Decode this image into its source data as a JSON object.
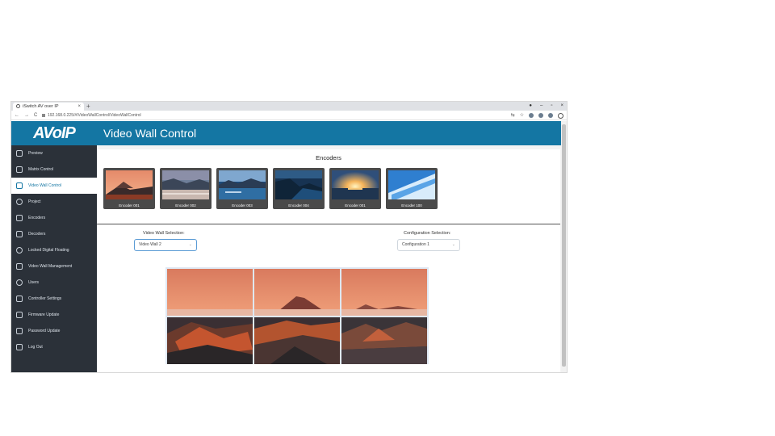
{
  "browser": {
    "tab_title": "iSwitch AV over IP",
    "tab_close": "×",
    "new_tab": "+",
    "url": "192.168.0.225/#/VideoWallControl/VideoWallControl",
    "nav_back": "←",
    "nav_forward": "→",
    "nav_reload": "C",
    "minimize": "–",
    "maximize": "▫",
    "close": "×",
    "menu": "⋮"
  },
  "app": {
    "logo": "AVoIP",
    "page_title": "Video Wall Control"
  },
  "sidebar": {
    "items": [
      {
        "label": "Preview",
        "icon": "preview-icon"
      },
      {
        "label": "Matrix Control",
        "icon": "matrix-icon"
      },
      {
        "label": "Video Wall Control",
        "icon": "video-wall-icon",
        "active": true
      },
      {
        "label": "Project",
        "icon": "project-icon"
      },
      {
        "label": "Encoders",
        "icon": "encoder-icon"
      },
      {
        "label": "Decoders",
        "icon": "decoder-icon"
      },
      {
        "label": "Locked Digital Floating",
        "icon": "gear-icon"
      },
      {
        "label": "Video Wall Management",
        "icon": "wall-management-icon"
      },
      {
        "label": "Users",
        "icon": "user-icon"
      },
      {
        "label": "Controller Settings",
        "icon": "settings-sliders-icon"
      },
      {
        "label": "Firmware Update",
        "icon": "firmware-icon"
      },
      {
        "label": "Password Update",
        "icon": "key-icon"
      },
      {
        "label": "Log Out",
        "icon": "logout-icon"
      }
    ]
  },
  "encoders": {
    "title": "Encoders",
    "items": [
      {
        "label": "Encoder 001"
      },
      {
        "label": "Encoder 002"
      },
      {
        "label": "Encoder 003"
      },
      {
        "label": "Encoder 004"
      },
      {
        "label": "Encoder 001"
      },
      {
        "label": "Encoder 100"
      }
    ]
  },
  "video_wall_selection": {
    "label": "Video Wall Selection:",
    "value": "Video Wall 2"
  },
  "configuration_selection": {
    "label": "Configuration Selection:",
    "value": "Configuration 1"
  },
  "colors": {
    "brand_blue": "#1476a3",
    "sidebar_bg": "#2b3139"
  }
}
